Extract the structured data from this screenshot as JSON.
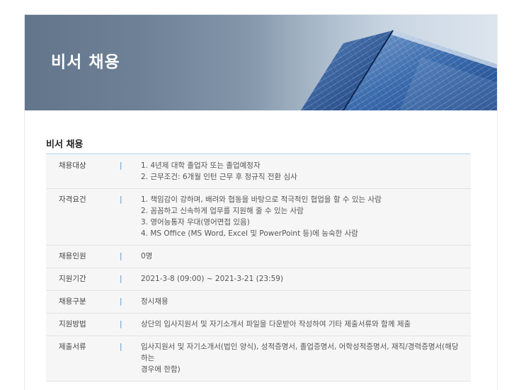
{
  "banner": {
    "title": "비서 채용"
  },
  "section": {
    "title": "비서 채용"
  },
  "separator": "|",
  "rows": [
    {
      "label": "채용대상",
      "lines": [
        "1. 4년제 대학 졸업자 또는 졸업예정자",
        "2. 근무조건: 6개월 인턴 근무 후 정규직 전환 심사"
      ]
    },
    {
      "label": "자격요건",
      "lines": [
        "1. 책임감이 강하며, 배려와 협동을 바탕으로 적극적인 협업을 할 수 있는 사람",
        "2. 꼼꼼하고 신속하게 업무를 지원해 줄 수 있는 사람",
        "3. 영어능통자 우대(영어면접 있음)",
        "4. MS Office (MS Word, Excel 및 PowerPoint 등)에 능숙한 사람"
      ]
    },
    {
      "label": "채용인원",
      "lines": [
        "0명"
      ]
    },
    {
      "label": "지원기간",
      "lines": [
        "2021-3-8 (09:00) ~ 2021-3-21 (23:59)"
      ]
    },
    {
      "label": "채용구분",
      "lines": [
        "정시채용"
      ]
    },
    {
      "label": "지원방법",
      "lines": [
        "상단의 입사지원서 및 자기소개서 파일을 다운받아 작성하여 기타 제출서류와 함께 제출"
      ]
    },
    {
      "label": "제출서류",
      "lines": [
        "입사지원서 및 자기소개서(법인 양식), 성적증명서, 졸업증명서, 어학성적증명서, 재직/경력증명서(해당하는",
        "경우에 한함)"
      ]
    }
  ]
}
